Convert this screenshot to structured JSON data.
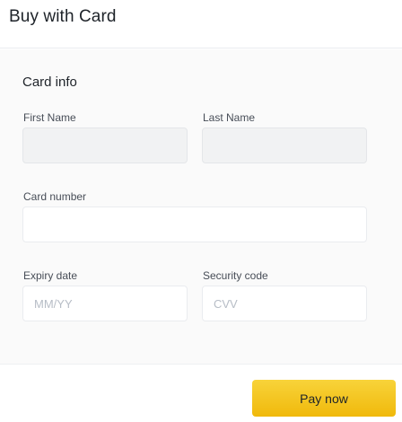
{
  "header": {
    "title": "Buy with Card"
  },
  "card_info": {
    "section_title": "Card info",
    "first_name": {
      "label": "First Name",
      "value": ""
    },
    "last_name": {
      "label": "Last Name",
      "value": ""
    },
    "card_number": {
      "label": "Card number",
      "value": "",
      "placeholder": ""
    },
    "expiry_date": {
      "label": "Expiry date",
      "placeholder": "MM/YY"
    },
    "security_code": {
      "label": "Security code",
      "placeholder": "CVV"
    }
  },
  "footer": {
    "pay_label": "Pay now"
  },
  "colors": {
    "accent": "#f0b90b",
    "text": "#1e2329",
    "label": "#474d57",
    "disabled_field": "#f1f2f3",
    "border": "#eaecef"
  }
}
